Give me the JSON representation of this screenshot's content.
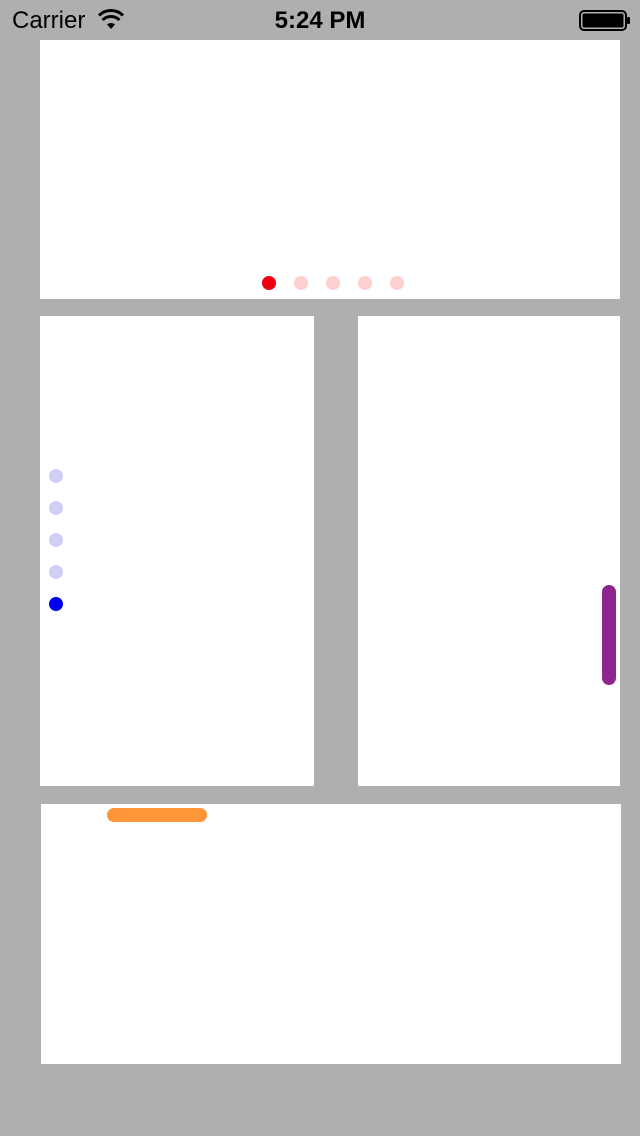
{
  "status_bar": {
    "carrier": "Carrier",
    "time": "5:24 PM",
    "wifi_icon": "wifi-icon",
    "battery_icon": "battery-icon"
  },
  "colors": {
    "background": "#afafaf",
    "panel": "#ffffff",
    "red_active": "#f0000f",
    "red_inactive": "#fdd0d0",
    "blue_active": "#0000ee",
    "blue_inactive": "#d0d0f7",
    "purple_indicator": "#8e2690",
    "orange_indicator": "#ff9438"
  },
  "top_panel": {
    "page_control": {
      "page_count": 5,
      "current_page": 1
    }
  },
  "left_panel": {
    "page_control": {
      "page_count": 5,
      "current_page": 5
    }
  },
  "right_panel": {
    "scroll_indicator": {
      "orientation": "vertical"
    }
  },
  "bottom_panel": {
    "scroll_indicator": {
      "orientation": "horizontal"
    }
  }
}
